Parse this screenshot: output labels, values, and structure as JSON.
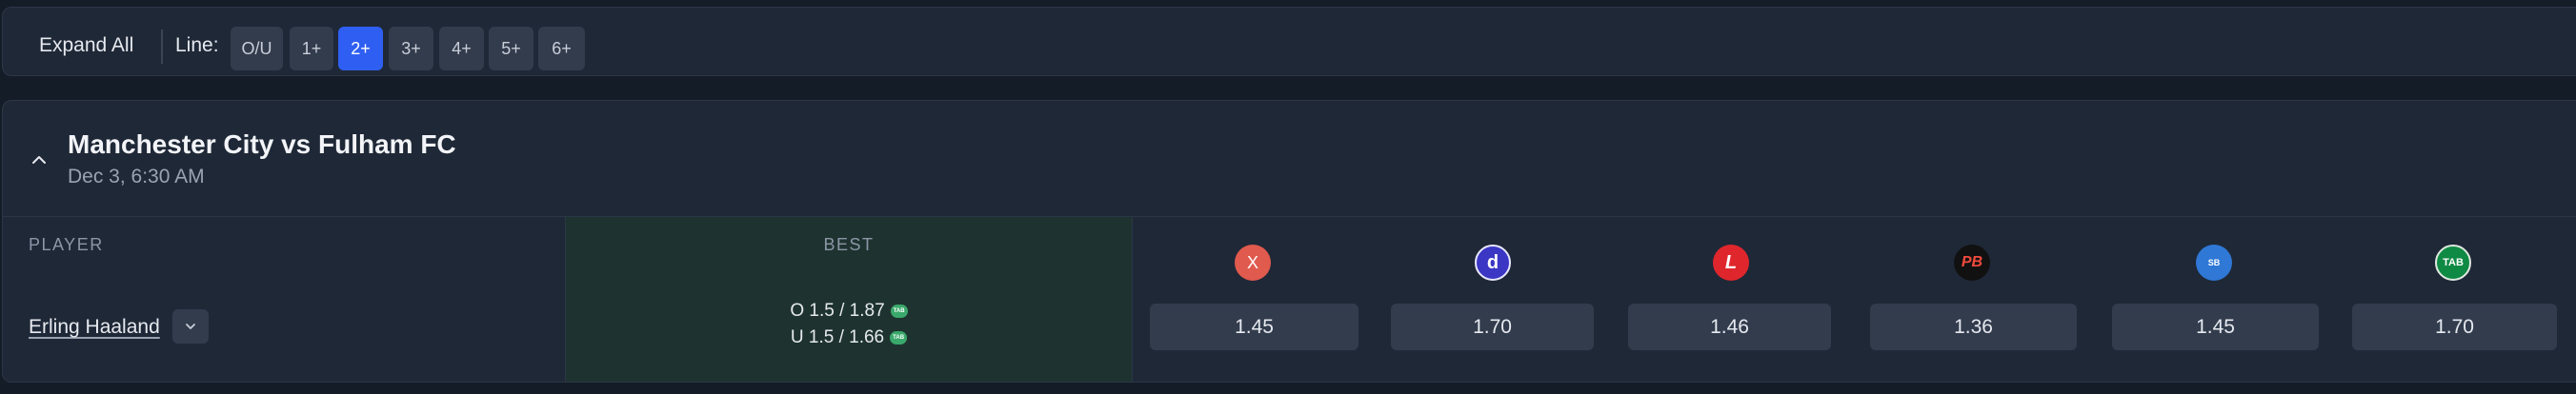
{
  "toolbar": {
    "expand_label": "Expand All",
    "line_label": "Line:",
    "line_options": [
      "O/U",
      "1+",
      "2+",
      "3+",
      "4+",
      "5+",
      "6+"
    ],
    "selected_line": "2+"
  },
  "match": {
    "title": "Manchester City vs Fulham FC",
    "datetime": "Dec 3, 6:30 AM"
  },
  "table": {
    "header_player": "PLAYER",
    "header_best": "BEST",
    "bookmakers": [
      {
        "icon": "x-logo-icon",
        "glyph": "X",
        "color": "#e05a4e"
      },
      {
        "icon": "dabble-logo-icon",
        "glyph": "d",
        "color": "#3b36c4"
      },
      {
        "icon": "ladbrokes-logo-icon",
        "glyph": "L",
        "color": "#e0262d"
      },
      {
        "icon": "pointsbet-logo-icon",
        "glyph": "PB",
        "color": "#111111"
      },
      {
        "icon": "sportsbet-logo-icon",
        "glyph": "SB",
        "color": "#2f78d6"
      },
      {
        "icon": "tab-logo-icon",
        "glyph": "TAB",
        "color": "#0f8a44"
      }
    ],
    "rows": [
      {
        "player": "Erling Haaland",
        "best_over": "O 1.5 / 1.87",
        "best_under": "U 1.5 / 1.66",
        "best_book_badge": "TAB",
        "odds": [
          "1.45",
          "1.70",
          "1.46",
          "1.36",
          "1.45",
          "1.70"
        ]
      }
    ]
  },
  "colors": {
    "accent": "#2f5ff2",
    "best_column_bg": "#1e3330"
  }
}
